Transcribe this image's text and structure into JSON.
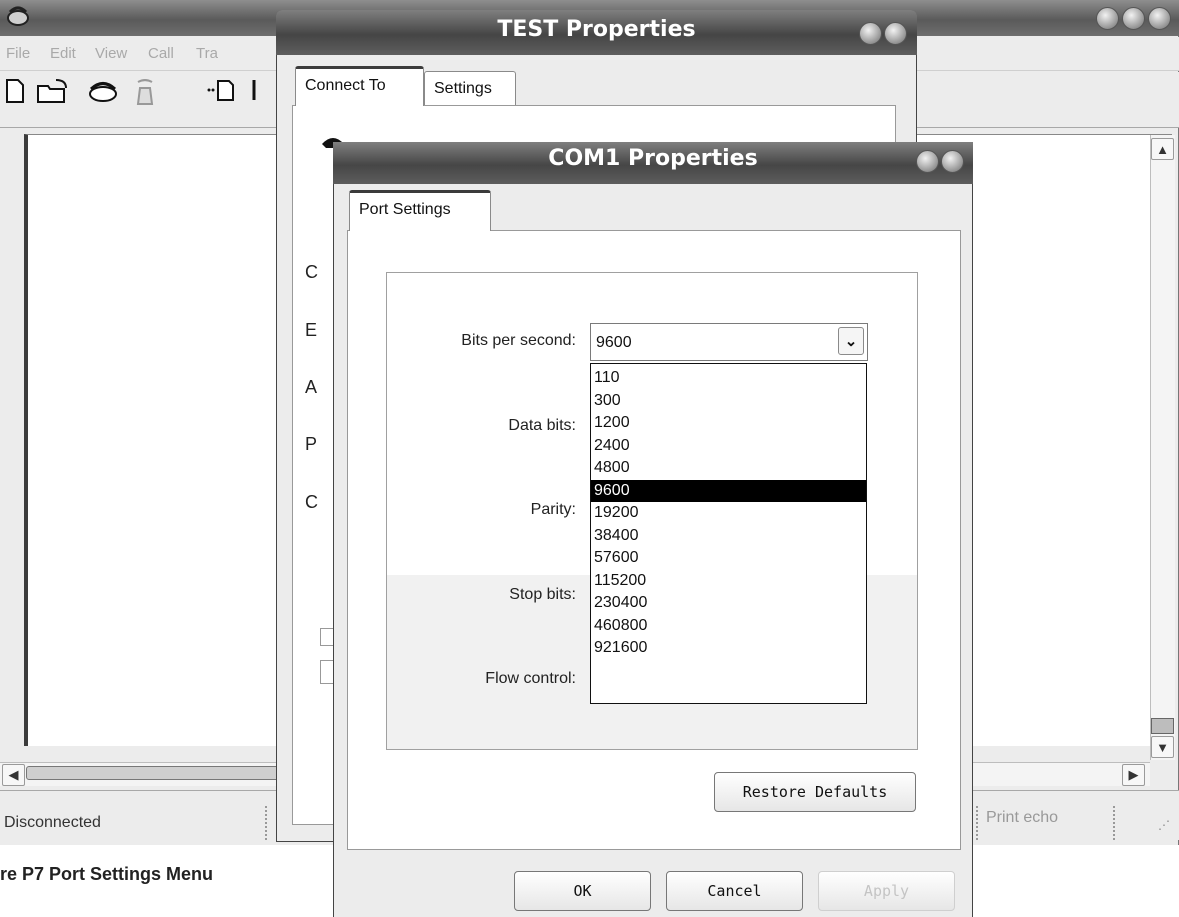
{
  "main_window": {
    "menu": [
      "File",
      "Edit",
      "View",
      "Call",
      "Tra"
    ],
    "status": {
      "connection": "Disconnected",
      "print_echo": "Print echo"
    }
  },
  "test_dialog": {
    "title": "TEST Properties",
    "tabs": [
      "Connect To",
      "Settings"
    ],
    "label_fragments": [
      "C",
      "E",
      "A",
      "P",
      "C"
    ]
  },
  "com_dialog": {
    "title": "COM1 Properties",
    "tab": "Port Settings",
    "labels": {
      "bits_per_second": "Bits per second:",
      "data_bits": "Data bits:",
      "parity": "Parity:",
      "stop_bits": "Stop bits:",
      "flow_control": "Flow control:"
    },
    "bits_per_second_value": "9600",
    "bits_per_second_options": [
      "110",
      "300",
      "1200",
      "2400",
      "4800",
      "9600",
      "19200",
      "38400",
      "57600",
      "115200",
      "230400",
      "460800",
      "921600"
    ],
    "selected_option": "9600",
    "buttons": {
      "restore_defaults": "Restore Defaults",
      "ok": "OK",
      "cancel": "Cancel",
      "apply": "Apply"
    }
  },
  "caption": "re P7  Port Settings Menu"
}
